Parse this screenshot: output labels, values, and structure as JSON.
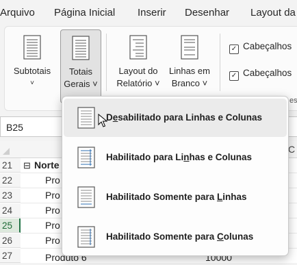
{
  "menu": [
    "Arquivo",
    "Página Inicial",
    "Inserir",
    "Desenhar",
    "Layout da"
  ],
  "ribbon": {
    "buttons": [
      {
        "line1": "Subtotais",
        "line2": "˅"
      },
      {
        "line1": "Totais",
        "line2": "Gerais ˅"
      },
      {
        "line1": "Layout do",
        "line2": "Relatório ˅"
      },
      {
        "line1": "Linhas em",
        "line2": "Branco ˅"
      }
    ],
    "checkboxes": [
      "Cabeçalhos",
      "Cabeçalhos"
    ],
    "check_mark": "✓",
    "group_fragment": "es"
  },
  "namebox": "B25",
  "sheet": {
    "column_letter": "C",
    "rows": [
      {
        "num": "21",
        "toggle": "⊟",
        "label": "Norte",
        "value": ""
      },
      {
        "num": "22",
        "toggle": "",
        "label": "Pro",
        "value": ""
      },
      {
        "num": "23",
        "toggle": "",
        "label": "Pro",
        "value": ""
      },
      {
        "num": "24",
        "toggle": "",
        "label": "Pro",
        "value": ""
      },
      {
        "num": "25",
        "toggle": "",
        "label": "Pro",
        "value": ""
      },
      {
        "num": "26",
        "toggle": "",
        "label": "Pro",
        "value": ""
      },
      {
        "num": "27",
        "toggle": "",
        "label": "Produto 6",
        "value": "10000"
      }
    ],
    "active_row": "25"
  },
  "dropdown": {
    "options": [
      {
        "pre": "D",
        "key": "e",
        "post": "sabilitado para Linhas e Colunas",
        "hover": true
      },
      {
        "pre": "Habilitado para Li",
        "key": "n",
        "post": "has e Colunas",
        "hover": false
      },
      {
        "pre": "Habilitado Somente para ",
        "key": "L",
        "post": "inhas",
        "hover": false
      },
      {
        "pre": "Habilitado Somente para ",
        "key": "C",
        "post": "olunas",
        "hover": false
      }
    ]
  },
  "colors": {
    "accent": "#217346",
    "selected_button": "#e2e2e2",
    "hover": "#ebebeb"
  }
}
